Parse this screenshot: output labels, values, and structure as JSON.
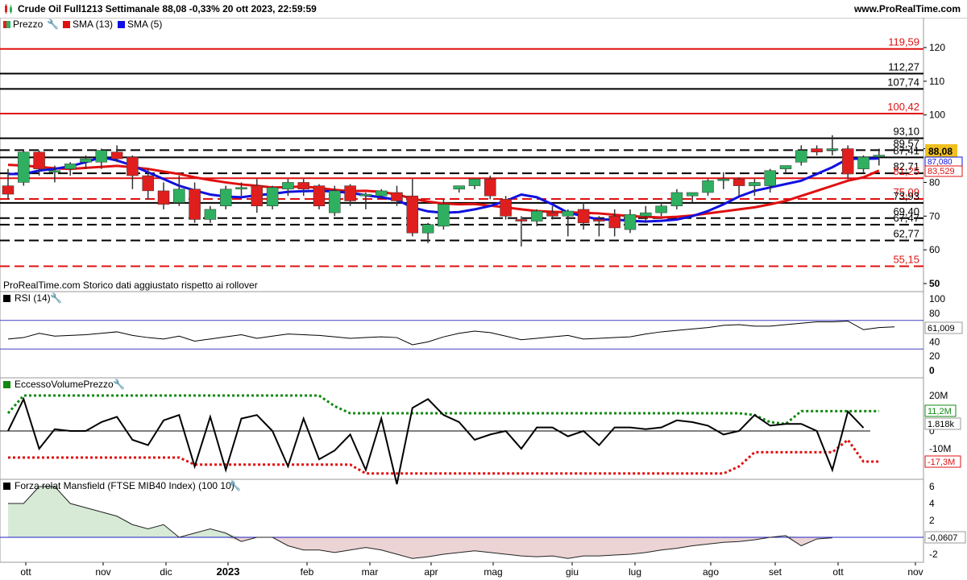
{
  "header": {
    "title": "Crude Oil Full1213 Settimanale 88,08 -0,33% 20 ott 2023, 22:59:59",
    "brand": "www.ProRealTime.com"
  },
  "colors": {
    "up": "#2eb060",
    "down": "#e01e1e",
    "sma13": "#e01010",
    "sma5": "#1010e0",
    "green_band": "#118811",
    "red_band": "#e01010"
  },
  "panels": {
    "price": {
      "legend": [
        "Prezzo",
        "SMA (13)",
        "SMA (5)"
      ],
      "note": "ProRealTime.com  Storico dati aggiustato rispetto ai rollover",
      "price_tag": "88,08",
      "sma5_tag": "87,080",
      "sma13_tag": "83,529"
    },
    "rsi": {
      "legend": "RSI (14)",
      "value_tag": "61,009"
    },
    "evp": {
      "legend": "EccessoVolumePrezzo",
      "upper_tag": "11,2M",
      "value_tag": "1.818k",
      "lower_tag": "-17,3M"
    },
    "mansfield": {
      "legend": "Forza relat Mansfield (FTSE MIB40 Index) (100 10)",
      "value_tag": "-0,0607"
    }
  },
  "chart_data": {
    "type": "candlestick",
    "x_labels": [
      "ott",
      "nov",
      "dic",
      "2023",
      "feb",
      "mar",
      "apr",
      "mag",
      "giu",
      "lug",
      "ago",
      "set",
      "ott",
      "nov"
    ],
    "price_axis_ticks": [
      120,
      110,
      100,
      90,
      80,
      70,
      60,
      50
    ],
    "levels": [
      {
        "value": 119.59,
        "label": "119,59",
        "color": "red",
        "style": "solid"
      },
      {
        "value": 112.27,
        "label": "112,27",
        "color": "black",
        "style": "solid"
      },
      {
        "value": 107.74,
        "label": "107,74",
        "color": "black",
        "style": "solid"
      },
      {
        "value": 100.42,
        "label": "100,42",
        "color": "red",
        "style": "solid"
      },
      {
        "value": 93.1,
        "label": "93,10",
        "color": "black",
        "style": "solid"
      },
      {
        "value": 89.57,
        "label": "89,57",
        "color": "black",
        "style": "dashed"
      },
      {
        "value": 87.41,
        "label": "87,41",
        "color": "black",
        "style": "solid"
      },
      {
        "value": 82.71,
        "label": "82,71",
        "color": "black",
        "style": "dashed"
      },
      {
        "value": 81.25,
        "label": "81,25",
        "color": "red",
        "style": "solid"
      },
      {
        "value": 75.09,
        "label": "75,09",
        "color": "red",
        "style": "dashed"
      },
      {
        "value": 73.93,
        "label": "73,93",
        "color": "black",
        "style": "solid"
      },
      {
        "value": 69.4,
        "label": "69,40",
        "color": "black",
        "style": "dashed"
      },
      {
        "value": 67.47,
        "label": "67,47",
        "color": "black",
        "style": "dashed"
      },
      {
        "value": 62.77,
        "label": "62,77",
        "color": "black",
        "style": "dashed"
      },
      {
        "value": 55.15,
        "label": "55,15",
        "color": "red",
        "style": "dashed"
      }
    ],
    "candles": [
      {
        "o": 79,
        "h": 84,
        "l": 75,
        "c": 76.5
      },
      {
        "o": 80,
        "h": 89.5,
        "l": 79,
        "c": 89
      },
      {
        "o": 89,
        "h": 89.5,
        "l": 82,
        "c": 84
      },
      {
        "o": 83,
        "h": 85,
        "l": 80,
        "c": 83.5
      },
      {
        "o": 84,
        "h": 86,
        "l": 82,
        "c": 85.5
      },
      {
        "o": 86,
        "h": 88,
        "l": 84,
        "c": 87
      },
      {
        "o": 86,
        "h": 90,
        "l": 84,
        "c": 89.5
      },
      {
        "o": 89,
        "h": 91,
        "l": 86,
        "c": 87
      },
      {
        "o": 87.5,
        "h": 88,
        "l": 78,
        "c": 82
      },
      {
        "o": 82,
        "h": 84,
        "l": 75,
        "c": 77.5
      },
      {
        "o": 77.5,
        "h": 80,
        "l": 72,
        "c": 73.5
      },
      {
        "o": 74,
        "h": 82,
        "l": 73,
        "c": 78
      },
      {
        "o": 78,
        "h": 80,
        "l": 68,
        "c": 69
      },
      {
        "o": 69,
        "h": 73,
        "l": 68,
        "c": 72
      },
      {
        "o": 73,
        "h": 79,
        "l": 72,
        "c": 78
      },
      {
        "o": 78,
        "h": 80,
        "l": 76,
        "c": 78.5
      },
      {
        "o": 79,
        "h": 81,
        "l": 71,
        "c": 73
      },
      {
        "o": 73,
        "h": 79,
        "l": 72,
        "c": 78.5
      },
      {
        "o": 78,
        "h": 81,
        "l": 76,
        "c": 80
      },
      {
        "o": 80,
        "h": 81,
        "l": 76,
        "c": 78
      },
      {
        "o": 79,
        "h": 79.5,
        "l": 72,
        "c": 73
      },
      {
        "o": 71,
        "h": 79,
        "l": 70,
        "c": 77.5
      },
      {
        "o": 79,
        "h": 79.5,
        "l": 73,
        "c": 74.5
      },
      {
        "o": 76,
        "h": 77,
        "l": 72,
        "c": 76.5
      },
      {
        "o": 76,
        "h": 78,
        "l": 75,
        "c": 77.5
      },
      {
        "o": 77,
        "h": 79,
        "l": 73,
        "c": 74.5
      },
      {
        "o": 76,
        "h": 81,
        "l": 64,
        "c": 65
      },
      {
        "o": 65,
        "h": 68,
        "l": 62,
        "c": 67.5
      },
      {
        "o": 67,
        "h": 75,
        "l": 66,
        "c": 73.5
      },
      {
        "o": 78,
        "h": 79,
        "l": 77,
        "c": 79
      },
      {
        "o": 79,
        "h": 81,
        "l": 78,
        "c": 81
      },
      {
        "o": 81,
        "h": 82,
        "l": 75,
        "c": 76
      },
      {
        "o": 75,
        "h": 76,
        "l": 69,
        "c": 70
      },
      {
        "o": 69,
        "h": 70,
        "l": 61,
        "c": 68.5
      },
      {
        "o": 68.5,
        "h": 72,
        "l": 67,
        "c": 71.5
      },
      {
        "o": 71,
        "h": 73,
        "l": 69,
        "c": 70
      },
      {
        "o": 70,
        "h": 72,
        "l": 64,
        "c": 71.5
      },
      {
        "o": 72,
        "h": 74,
        "l": 66,
        "c": 68
      },
      {
        "o": 69,
        "h": 70,
        "l": 64,
        "c": 68.5
      },
      {
        "o": 70,
        "h": 72,
        "l": 64,
        "c": 66.5
      },
      {
        "o": 66,
        "h": 72,
        "l": 65,
        "c": 70.5
      },
      {
        "o": 70,
        "h": 73,
        "l": 68,
        "c": 71
      },
      {
        "o": 71,
        "h": 74,
        "l": 70,
        "c": 73
      },
      {
        "o": 73,
        "h": 78,
        "l": 72,
        "c": 77
      },
      {
        "o": 76,
        "h": 77,
        "l": 74,
        "c": 77
      },
      {
        "o": 77,
        "h": 81,
        "l": 76,
        "c": 80.5
      },
      {
        "o": 81,
        "h": 83,
        "l": 78,
        "c": 81
      },
      {
        "o": 81,
        "h": 81.5,
        "l": 76,
        "c": 79
      },
      {
        "o": 79,
        "h": 81,
        "l": 76,
        "c": 80
      },
      {
        "o": 79,
        "h": 84,
        "l": 77,
        "c": 83.5
      },
      {
        "o": 84,
        "h": 85,
        "l": 83,
        "c": 85
      },
      {
        "o": 86,
        "h": 91,
        "l": 85,
        "c": 89.5
      },
      {
        "o": 90,
        "h": 91,
        "l": 88,
        "c": 89
      },
      {
        "o": 90,
        "h": 94,
        "l": 88,
        "c": 90
      },
      {
        "o": 90,
        "h": 91,
        "l": 81,
        "c": 82.5
      },
      {
        "o": 84,
        "h": 88,
        "l": 83,
        "c": 87.5
      },
      {
        "o": 88,
        "h": 90,
        "l": 85,
        "c": 88.08
      }
    ],
    "sma13": [
      85.2,
      85,
      84.6,
      84.2,
      84,
      84.3,
      84.6,
      84.9,
      84.5,
      84,
      83.2,
      82.5,
      81.5,
      80.7,
      80,
      79.4,
      79,
      78.5,
      78.6,
      78.8,
      78.3,
      77.8,
      77.4,
      77.5,
      77.2,
      76.4,
      75.2,
      74.3,
      73.7,
      73.5,
      73.6,
      73.1,
      72.6,
      72,
      71.5,
      71.3,
      71.1,
      71,
      70.8,
      70.4,
      70,
      69.8,
      69.6,
      69.8,
      70.2,
      70.8,
      71.4,
      72,
      72.6,
      73.5,
      74.5,
      76,
      77.5,
      79,
      80.5,
      81.5,
      83.5
    ],
    "sma5": [
      82.5,
      82.5,
      83.5,
      84,
      84.8,
      86,
      87.5,
      86.5,
      85,
      83,
      81,
      79,
      77.6,
      76.4,
      75.8,
      75.6,
      76.2,
      76.6,
      77.2,
      77.4,
      77.5,
      77.3,
      76.9,
      76.2,
      75.6,
      74.8,
      72.6,
      71.4,
      71,
      71.2,
      72,
      73,
      74.5,
      76.4,
      75.6,
      73.5,
      71,
      70,
      69,
      69,
      68.6,
      68.4,
      68.6,
      69,
      70,
      71.5,
      73.5,
      75.8,
      77.5,
      78.5,
      79.5,
      80.5,
      82.5,
      84.5,
      87,
      87,
      87.08
    ],
    "rsi": [
      44,
      46,
      52,
      48,
      49,
      50,
      52,
      54,
      49,
      46,
      44,
      48,
      41,
      44,
      47,
      50,
      45,
      48,
      51,
      50,
      49,
      47,
      45,
      46,
      47,
      46,
      36,
      40,
      47,
      52,
      55,
      53,
      48,
      43,
      45,
      47,
      49,
      44,
      45,
      46,
      47,
      51,
      54,
      56,
      58,
      60,
      63,
      64,
      62,
      62,
      64,
      66,
      68,
      68,
      69,
      57,
      60,
      61
    ],
    "evp": {
      "main": [
        0,
        18,
        -10,
        1,
        0,
        0,
        5,
        8,
        -5,
        -8,
        6,
        9,
        -20,
        8,
        -22,
        7,
        9,
        0,
        -20,
        7,
        -16,
        -11,
        -2,
        -22,
        7,
        -30,
        13,
        18,
        9,
        5,
        -5,
        -2,
        0,
        -10,
        2,
        2,
        -3,
        0,
        -8,
        2,
        2,
        1,
        2,
        6,
        5,
        3,
        -2,
        0,
        9,
        3,
        4,
        4,
        0,
        -22,
        11,
        1.8
      ],
      "upper": [
        10,
        20,
        20,
        20,
        20,
        20,
        20,
        20,
        20,
        20,
        20,
        20,
        20,
        20,
        20,
        20,
        20,
        20,
        20,
        20,
        20,
        14,
        10,
        10,
        10,
        10,
        10,
        10,
        10,
        10,
        10,
        10,
        10,
        10,
        10,
        10,
        10,
        10,
        10,
        10,
        10,
        10,
        10,
        10,
        10,
        10,
        10,
        10,
        9,
        5,
        4,
        11.2,
        11.2,
        11.2,
        11.2,
        11.2,
        11.2
      ],
      "lower": [
        -15,
        -15,
        -15,
        -15,
        -15,
        -15,
        -15,
        -15,
        -15,
        -15,
        -15,
        -15,
        -19,
        -19,
        -19,
        -19,
        -19,
        -19,
        -19,
        -19,
        -19,
        -19,
        -19,
        -24,
        -24,
        -24,
        -24,
        -24,
        -24,
        -24,
        -24,
        -24,
        -24,
        -24,
        -24,
        -24,
        -24,
        -24,
        -24,
        -24,
        -24,
        -24,
        -24,
        -24,
        -24,
        -24,
        -24,
        -20,
        -12,
        -12,
        -12,
        -12,
        -12,
        -12,
        -5,
        -17.3,
        -17.3
      ]
    },
    "mansfield": [
      4,
      4,
      6,
      6,
      4,
      3.5,
      3,
      2.5,
      1.5,
      1,
      1.5,
      0,
      0.5,
      1,
      0.5,
      -0.5,
      0,
      0,
      -1,
      -1.5,
      -1.5,
      -1.8,
      -1.5,
      -1.2,
      -1.5,
      -2,
      -2.5,
      -2.3,
      -2,
      -1.8,
      -1.6,
      -1.8,
      -2,
      -2.2,
      -2.3,
      -2.2,
      -2.5,
      -2.2,
      -2.2,
      -2.1,
      -2,
      -1.8,
      -1.5,
      -1.3,
      -1,
      -0.8,
      -0.6,
      -0.5,
      -0.3,
      0,
      0.2,
      -1,
      -0.2,
      -0.06
    ]
  }
}
